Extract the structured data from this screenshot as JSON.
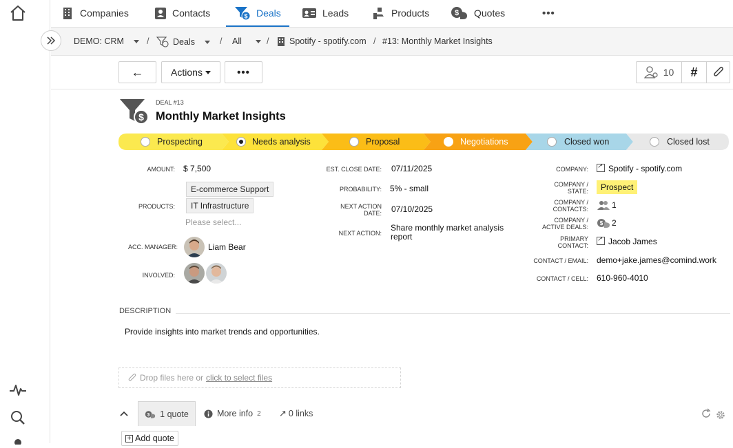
{
  "nav": {
    "tabs": [
      {
        "label": "Companies",
        "icon": "building-icon"
      },
      {
        "label": "Contacts",
        "icon": "contact-card-icon"
      },
      {
        "label": "Deals",
        "icon": "funnel-dollar-icon"
      },
      {
        "label": "Leads",
        "icon": "id-card-icon"
      },
      {
        "label": "Products",
        "icon": "products-icon"
      },
      {
        "label": "Quotes",
        "icon": "quotes-icon"
      }
    ],
    "more": "•••"
  },
  "breadcrumb": {
    "workspace": "DEMO: CRM",
    "module": "Deals",
    "filter": "All",
    "company": "Spotify - spotify.com",
    "record": "#13: Monthly Market Insights",
    "sep": "/"
  },
  "toolbar": {
    "back": "←",
    "actions": "Actions",
    "more": "•••",
    "followers_count": "10",
    "hash": "#"
  },
  "deal": {
    "kicker": "DEAL #13",
    "title": "Monthly Market Insights"
  },
  "stages": [
    {
      "label": "Prospecting",
      "color": "#fbe94f",
      "selected": false
    },
    {
      "label": "Needs analysis",
      "color": "#fde23a",
      "selected": true
    },
    {
      "label": "Proposal",
      "color": "#fbbd17",
      "selected": false
    },
    {
      "label": "Negotiations",
      "color": "#f8a214",
      "selected": false
    },
    {
      "label": "Closed won",
      "color": "#a8d6e8",
      "selected": false
    },
    {
      "label": "Closed lost",
      "color": "#e8e8e8",
      "selected": false
    }
  ],
  "fields": {
    "amount_label": "AMOUNT:",
    "amount": "$ 7,500",
    "products_label": "PRODUCTS:",
    "products": [
      "E-commerce Support",
      "IT Infrastructure"
    ],
    "products_placeholder": "Please select...",
    "acc_manager_label": "ACC. MANAGER:",
    "acc_manager": "Liam Bear",
    "involved_label": "INVOLVED:",
    "close_date_label": "EST. CLOSE DATE:",
    "close_date": "07/11/2025",
    "probability_label": "PROBABILITY:",
    "probability": "5% - small",
    "next_action_date_label_1": "NEXT ACTION",
    "next_action_date_label_2": "DATE:",
    "next_action_date": "07/10/2025",
    "next_action_label": "NEXT ACTION:",
    "next_action": "Share monthly market analysis report",
    "company_label": "COMPANY:",
    "company": "Spotify - spotify.com",
    "company_state_label_1": "COMPANY /",
    "company_state_label_2": "STATE:",
    "company_state": "Prospect",
    "company_contacts_label_1": "COMPANY /",
    "company_contacts_label_2": "CONTACTS:",
    "company_contacts": "1",
    "company_deals_label_1": "COMPANY /",
    "company_deals_label_2": "ACTIVE DEALS:",
    "company_deals": "2",
    "primary_contact_label_1": "PRIMARY",
    "primary_contact_label_2": "CONTACT:",
    "primary_contact": "Jacob James",
    "contact_email_label": "CONTACT / EMAIL:",
    "contact_email": "demo+jake.james@comind.work",
    "contact_cell_label": "CONTACT / CELL:",
    "contact_cell": "610-960-4010"
  },
  "description": {
    "heading": "DESCRIPTION",
    "text": "Provide insights into market trends and opportunities."
  },
  "dropzone": {
    "text": "Drop files here or",
    "link": "click to select files"
  },
  "bottom_tabs": {
    "quotes": "1 quote",
    "more_info": "More info",
    "more_info_count": "2",
    "links": "0 links",
    "add_quote": "Add quote"
  },
  "colors": {
    "accent": "#1a73c7",
    "state_badge": "#fff176"
  }
}
